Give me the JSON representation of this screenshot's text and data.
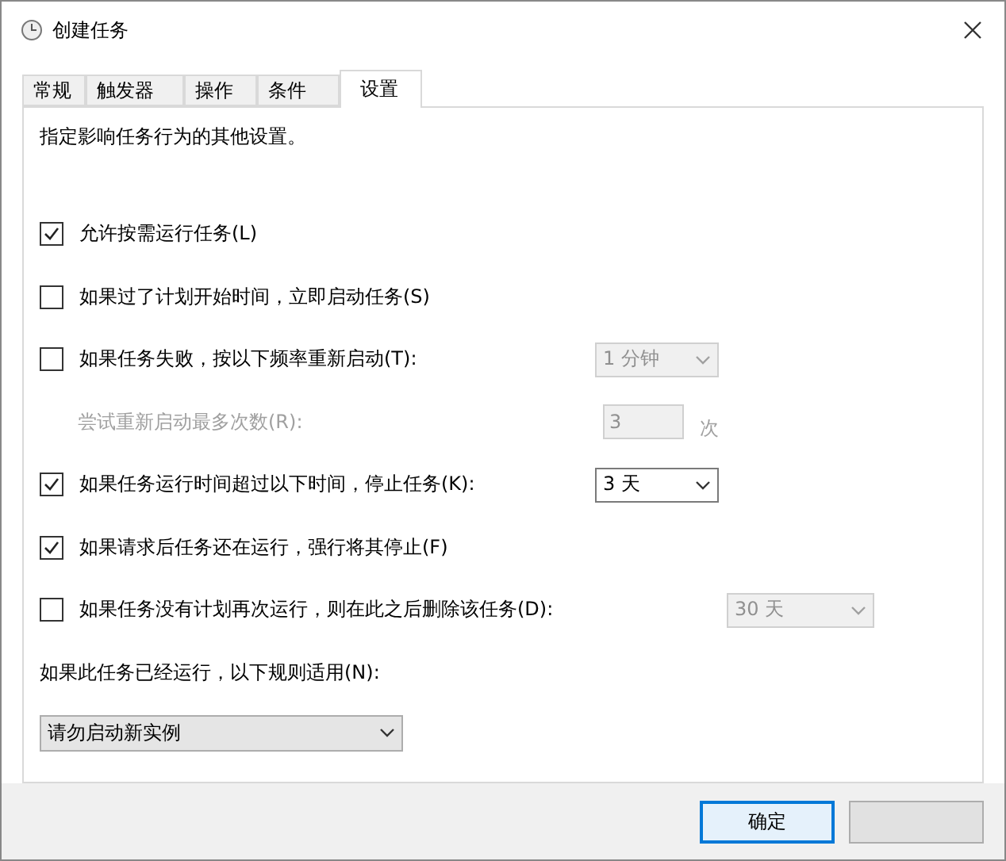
{
  "window": {
    "title": "创建任务"
  },
  "tabs": [
    {
      "label": "常规",
      "selected": false
    },
    {
      "label": "触发器",
      "selected": false
    },
    {
      "label": "操作",
      "selected": false
    },
    {
      "label": "条件",
      "selected": false
    },
    {
      "label": "设置",
      "selected": true
    }
  ],
  "description": "指定影响任务行为的其他设置。",
  "rows": [
    {
      "kind": "checkbox",
      "label": "允许按需运行任务(L)",
      "checked": true
    },
    {
      "kind": "checkbox",
      "label": "如果过了计划开始时间，立即启动任务(S)",
      "checked": false
    },
    {
      "kind": "checkbox",
      "label": "如果任务失败，按以下频率重新启动(T):",
      "checked": false,
      "control": {
        "kind": "dropdown",
        "value": "1 分钟",
        "disabled": true
      }
    },
    {
      "kind": "label",
      "label": "尝试重新启动最多次数(R):",
      "disabled": true,
      "control": {
        "kind": "number",
        "value": "3",
        "unit": "次",
        "disabled": true
      }
    },
    {
      "kind": "checkbox",
      "label": "如果任务运行时间超过以下时间，停止任务(K):",
      "checked": true,
      "control": {
        "kind": "dropdown",
        "value": "3 天",
        "disabled": false
      }
    },
    {
      "kind": "checkbox",
      "label": "如果请求后任务还在运行，强行将其停止(F)",
      "checked": true
    },
    {
      "kind": "checkbox",
      "label": "如果任务没有计划再次运行，则在此之后删除该任务(D):",
      "checked": false,
      "control": {
        "kind": "dropdown",
        "value": "30 天",
        "disabled": true,
        "wide": true
      }
    }
  ],
  "rule": {
    "label": "如果此任务已经运行，以下规则适用(N):",
    "value": "请勿启动新实例"
  },
  "buttons": [
    {
      "label": "确定",
      "default": true
    },
    {
      "default": false
    }
  ]
}
